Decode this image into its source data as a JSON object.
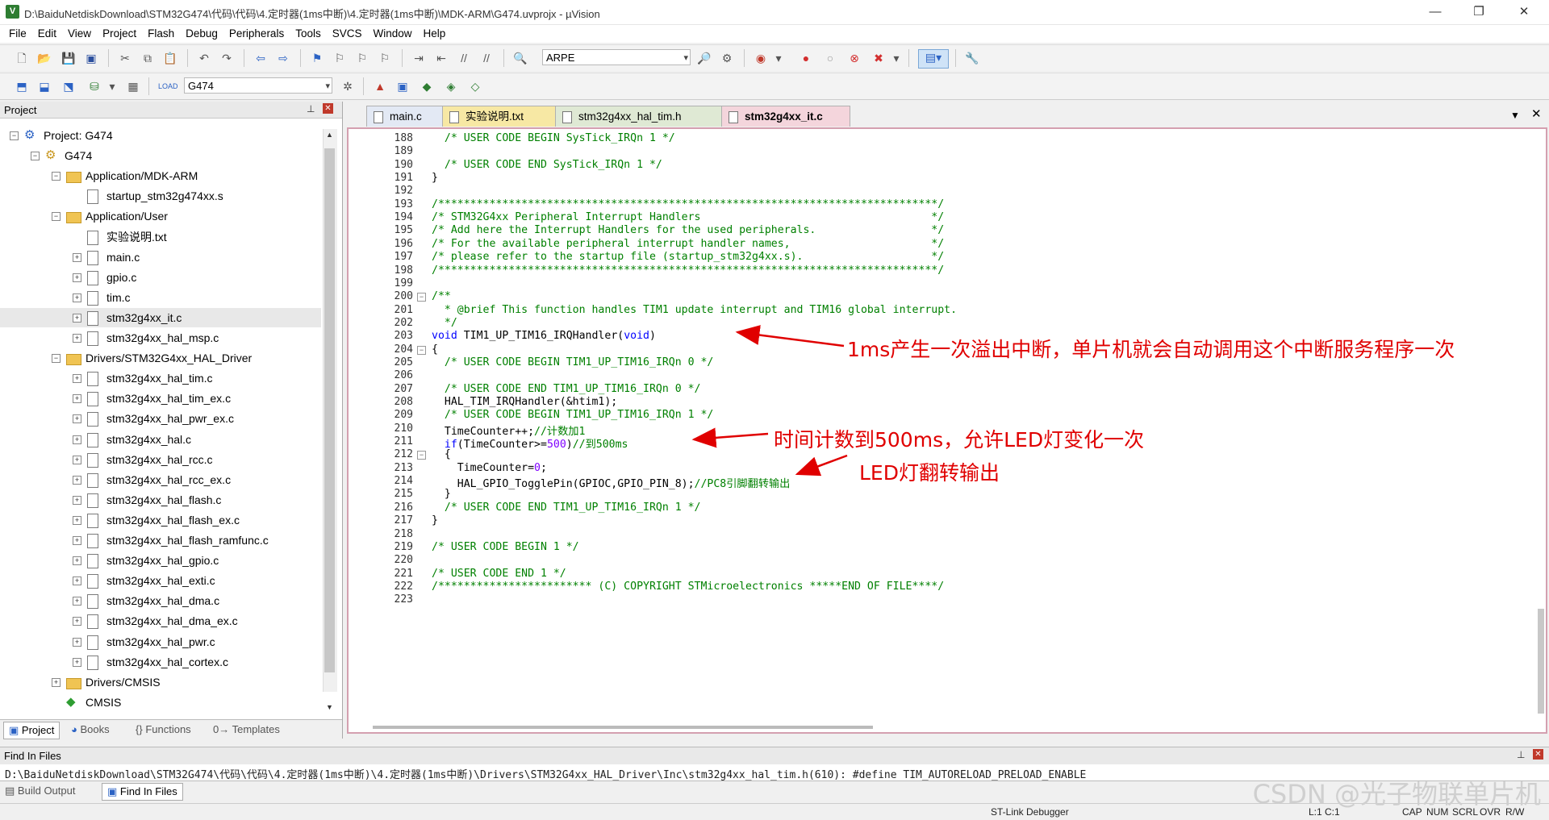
{
  "window": {
    "title": "D:\\BaiduNetdiskDownload\\STM32G474\\代码\\代码\\4.定时器(1ms中断)\\4.定时器(1ms中断)\\MDK-ARM\\G474.uvprojx - µVision",
    "minimize": "—",
    "maximize": "❐",
    "close": "✕"
  },
  "menu": [
    "File",
    "Edit",
    "View",
    "Project",
    "Flash",
    "Debug",
    "Peripherals",
    "Tools",
    "SVCS",
    "Window",
    "Help"
  ],
  "toolbar": {
    "search_combo": "ARPE",
    "target_combo": "G474"
  },
  "project_panel": {
    "title": "Project",
    "tree": [
      {
        "label": "Project: G474",
        "kind": "project"
      },
      {
        "label": "G474",
        "kind": "target"
      },
      {
        "label": "Application/MDK-ARM",
        "kind": "folder"
      },
      {
        "label": "startup_stm32g474xx.s",
        "kind": "file"
      },
      {
        "label": "Application/User",
        "kind": "folder"
      },
      {
        "label": "实验说明.txt",
        "kind": "file"
      },
      {
        "label": "main.c",
        "kind": "file"
      },
      {
        "label": "gpio.c",
        "kind": "file"
      },
      {
        "label": "tim.c",
        "kind": "file"
      },
      {
        "label": "stm32g4xx_it.c",
        "kind": "file"
      },
      {
        "label": "stm32g4xx_hal_msp.c",
        "kind": "file"
      },
      {
        "label": "Drivers/STM32G4xx_HAL_Driver",
        "kind": "folder"
      },
      {
        "label": "stm32g4xx_hal_tim.c",
        "kind": "file"
      },
      {
        "label": "stm32g4xx_hal_tim_ex.c",
        "kind": "file"
      },
      {
        "label": "stm32g4xx_hal_pwr_ex.c",
        "kind": "file"
      },
      {
        "label": "stm32g4xx_hal.c",
        "kind": "file"
      },
      {
        "label": "stm32g4xx_hal_rcc.c",
        "kind": "file"
      },
      {
        "label": "stm32g4xx_hal_rcc_ex.c",
        "kind": "file"
      },
      {
        "label": "stm32g4xx_hal_flash.c",
        "kind": "file"
      },
      {
        "label": "stm32g4xx_hal_flash_ex.c",
        "kind": "file"
      },
      {
        "label": "stm32g4xx_hal_flash_ramfunc.c",
        "kind": "file"
      },
      {
        "label": "stm32g4xx_hal_gpio.c",
        "kind": "file"
      },
      {
        "label": "stm32g4xx_hal_exti.c",
        "kind": "file"
      },
      {
        "label": "stm32g4xx_hal_dma.c",
        "kind": "file"
      },
      {
        "label": "stm32g4xx_hal_dma_ex.c",
        "kind": "file"
      },
      {
        "label": "stm32g4xx_hal_pwr.c",
        "kind": "file"
      },
      {
        "label": "stm32g4xx_hal_cortex.c",
        "kind": "file"
      },
      {
        "label": "Drivers/CMSIS",
        "kind": "folder"
      },
      {
        "label": "CMSIS",
        "kind": "component"
      }
    ],
    "tabs": [
      "Project",
      "Books",
      "Functions",
      "Templates"
    ]
  },
  "editor": {
    "tabs": [
      "main.c",
      "实验说明.txt",
      "stm32g4xx_hal_tim.h",
      "stm32g4xx_it.c"
    ],
    "active_tab": "stm32g4xx_it.c",
    "lines": [
      {
        "n": "188",
        "t": "  /* USER CODE BEGIN SysTick_IRQn 1 */"
      },
      {
        "n": "189",
        "t": ""
      },
      {
        "n": "190",
        "t": "  /* USER CODE END SysTick_IRQn 1 */"
      },
      {
        "n": "191",
        "t": "}"
      },
      {
        "n": "192",
        "t": ""
      },
      {
        "n": "193",
        "t": "/******************************************************************************/"
      },
      {
        "n": "194",
        "t": "/* STM32G4xx Peripheral Interrupt Handlers                                    */"
      },
      {
        "n": "195",
        "t": "/* Add here the Interrupt Handlers for the used peripherals.                  */"
      },
      {
        "n": "196",
        "t": "/* For the available peripheral interrupt handler names,                      */"
      },
      {
        "n": "197",
        "t": "/* please refer to the startup file (startup_stm32g4xx.s).                    */"
      },
      {
        "n": "198",
        "t": "/******************************************************************************/"
      },
      {
        "n": "199",
        "t": ""
      },
      {
        "n": "200",
        "t": "/**"
      },
      {
        "n": "201",
        "t": "  * @brief This function handles TIM1 update interrupt and TIM16 global interrupt."
      },
      {
        "n": "202",
        "t": "  */"
      },
      {
        "n": "203",
        "t": "void TIM1_UP_TIM16_IRQHandler(void)"
      },
      {
        "n": "204",
        "t": "{"
      },
      {
        "n": "205",
        "t": "  /* USER CODE BEGIN TIM1_UP_TIM16_IRQn 0 */"
      },
      {
        "n": "206",
        "t": ""
      },
      {
        "n": "207",
        "t": "  /* USER CODE END TIM1_UP_TIM16_IRQn 0 */"
      },
      {
        "n": "208",
        "t": "  HAL_TIM_IRQHandler(&htim1);"
      },
      {
        "n": "209",
        "t": "  /* USER CODE BEGIN TIM1_UP_TIM16_IRQn 1 */"
      },
      {
        "n": "210",
        "t": "  TimeCounter++;//计数加1"
      },
      {
        "n": "211",
        "t": "  if(TimeCounter>=500)//到500ms"
      },
      {
        "n": "212",
        "t": "  {"
      },
      {
        "n": "213",
        "t": "    TimeCounter=0;"
      },
      {
        "n": "214",
        "t": "    HAL_GPIO_TogglePin(GPIOC,GPIO_PIN_8);//PC8引脚翻转输出"
      },
      {
        "n": "215",
        "t": "  }"
      },
      {
        "n": "216",
        "t": "  /* USER CODE END TIM1_UP_TIM16_IRQn 1 */"
      },
      {
        "n": "217",
        "t": "}"
      },
      {
        "n": "218",
        "t": ""
      },
      {
        "n": "219",
        "t": "/* USER CODE BEGIN 1 */"
      },
      {
        "n": "220",
        "t": ""
      },
      {
        "n": "221",
        "t": "/* USER CODE END 1 */"
      },
      {
        "n": "222",
        "t": "/************************ (C) COPYRIGHT STMicroelectronics *****END OF FILE****/"
      },
      {
        "n": "223",
        "t": ""
      }
    ],
    "annotations": [
      "1ms产生一次溢出中断，单片机就会自动调用这个中断服务程序一次",
      "时间计数到500ms，允许LED灯变化一次",
      "LED灯翻转输出"
    ]
  },
  "find_panel": {
    "title": "Find In Files",
    "result_text": "D:\\BaiduNetdiskDownload\\STM32G474\\代码\\代码\\4.定时器(1ms中断)\\4.定时器(1ms中断)\\Drivers\\STM32G4xx_HAL_Driver\\Inc\\stm32g4xx_hal_tim.h(610):  #define TIM_AUTORELOAD_PRELOAD_ENABLE"
  },
  "bottom_tabs": [
    "Build Output",
    "Find In Files"
  ],
  "status": {
    "debugger": "ST-Link Debugger",
    "position": "L:1 C:1",
    "flags": [
      "CAP",
      "NUM",
      "SCRL",
      "OVR",
      "R/W"
    ]
  },
  "watermark": "CSDN @光子物联单片机"
}
